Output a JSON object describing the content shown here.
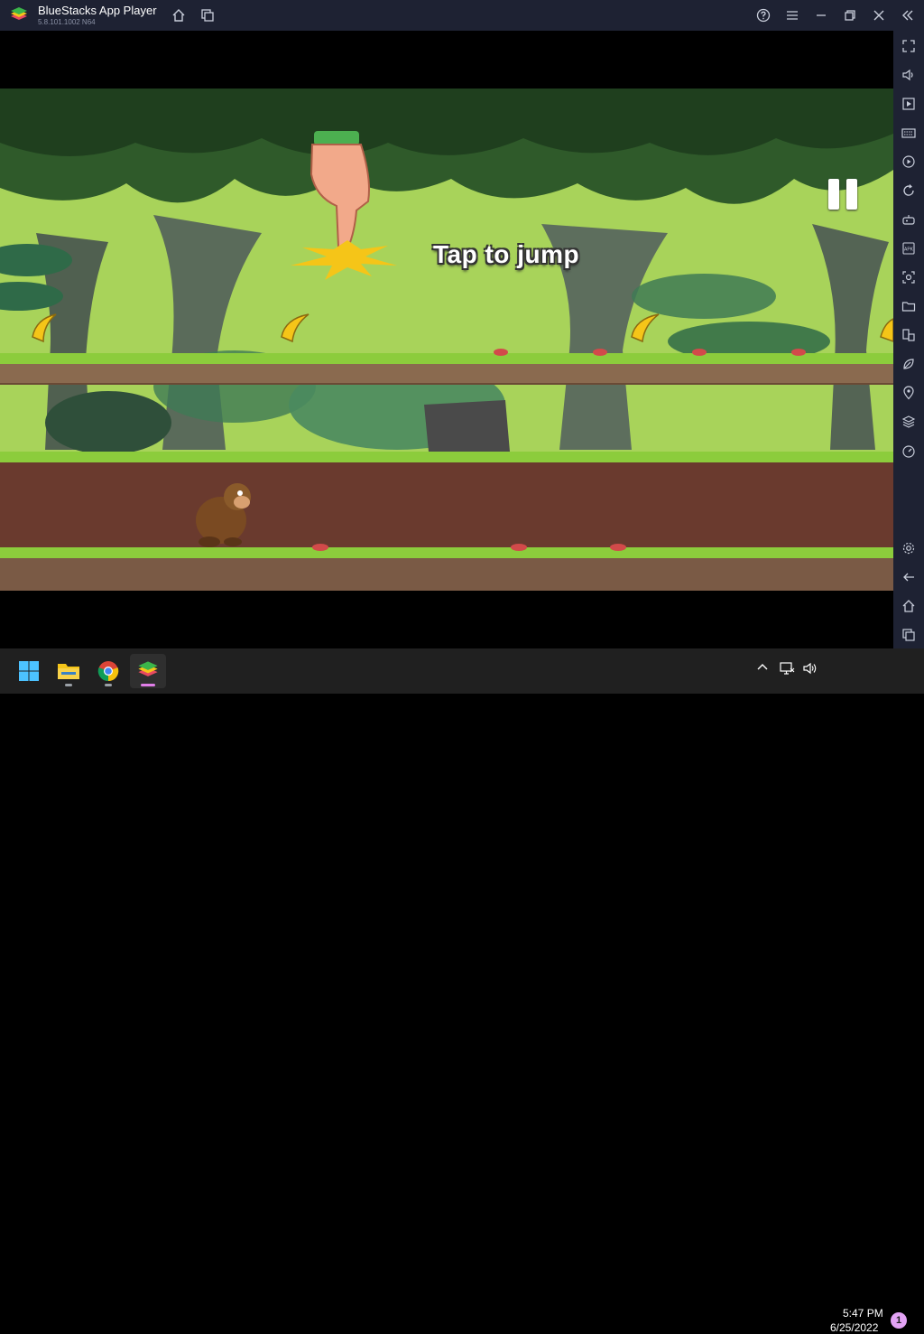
{
  "window": {
    "title": "BlueStacks App Player",
    "version": "5.8.101.1002 N64"
  },
  "game": {
    "hint_text": "Tap to jump"
  },
  "sidebar": {
    "items": [
      "fullscreen-icon",
      "volume-icon",
      "media-icon",
      "keyboard-icon",
      "macro-icon",
      "rotate-icon",
      "gamepad-icon",
      "apk-icon",
      "screenshot-icon",
      "folder-icon",
      "multi-instance-icon",
      "eco-icon",
      "location-icon",
      "layers-icon",
      "performance-icon",
      "settings-icon",
      "back-icon",
      "home-icon",
      "recents-icon"
    ]
  },
  "taskbar": {
    "time": "5:47 PM",
    "date": "6/25/2022",
    "notification_count": "1"
  },
  "colors": {
    "titlebar_bg": "#1e2233",
    "taskbar_bg": "#202020",
    "grass": "#8ccc3c",
    "dirt": "#6a3a2e"
  }
}
